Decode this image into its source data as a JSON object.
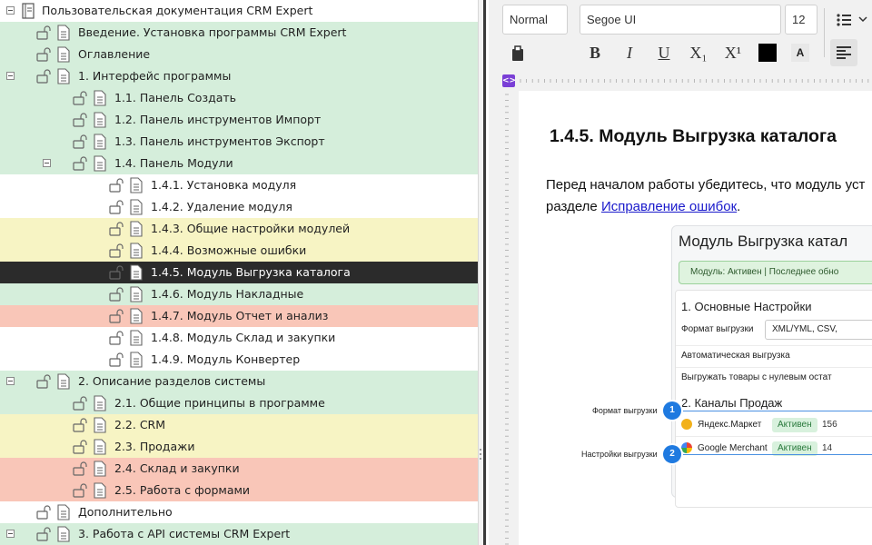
{
  "tree": {
    "root": "Пользовательская документация CRM Expert",
    "items": [
      {
        "label": "Введение. Установка программы CRM Expert",
        "color": "green"
      },
      {
        "label": "Оглавление",
        "color": "green"
      },
      {
        "label": "1. Интерфейс программы",
        "color": "green",
        "expanded": true
      },
      {
        "label": "1.1. Панель Создать",
        "color": "green"
      },
      {
        "label": "1.2. Панель инструментов Импорт",
        "color": "green"
      },
      {
        "label": "1.3. Панель инструментов Экспорт",
        "color": "green"
      },
      {
        "label": "1.4. Панель Модули",
        "color": "green",
        "expanded": true
      },
      {
        "label": "1.4.1. Установка модуля",
        "color": "white"
      },
      {
        "label": "1.4.2. Удаление модуля",
        "color": "white"
      },
      {
        "label": "1.4.3. Общие настройки модулей",
        "color": "yellow"
      },
      {
        "label": "1.4.4. Возможные ошибки",
        "color": "yellow"
      },
      {
        "label": "1.4.5. Модуль Выгрузка каталога",
        "color": "selected"
      },
      {
        "label": "1.4.6. Модуль Накладные",
        "color": "green"
      },
      {
        "label": "1.4.7. Модуль Отчет и анализ",
        "color": "red"
      },
      {
        "label": "1.4.8. Модуль Склад и закупки",
        "color": "white"
      },
      {
        "label": "1.4.9. Модуль Конвертер",
        "color": "white"
      },
      {
        "label": "2. Описание разделов системы",
        "color": "green",
        "expanded": true
      },
      {
        "label": "2.1. Общие принципы в программе",
        "color": "green"
      },
      {
        "label": "2.2. CRM",
        "color": "yellow"
      },
      {
        "label": "2.3. Продажи",
        "color": "yellow"
      },
      {
        "label": "2.4. Склад и закупки",
        "color": "red"
      },
      {
        "label": "2.5. Работа с формами",
        "color": "red"
      },
      {
        "label": "Дополнительно",
        "color": "white"
      },
      {
        "label": "3. Работа с API системы CRM Expert",
        "color": "green",
        "expanded": true
      }
    ]
  },
  "toolbar": {
    "style": "Normal",
    "font": "Segoe UI",
    "size": "12",
    "bold": "B",
    "italic": "I",
    "underline": "U",
    "subscript": "X₁",
    "superscript": "X¹",
    "highlight": "A"
  },
  "document": {
    "title": "1.4.5. Модуль Выгрузка каталога",
    "para_line1": "Перед началом работы убедитесь, что модуль уст",
    "para_line2_prefix": "разделе ",
    "para_link": "Исправление ошибок",
    "para_line2_suffix": "."
  },
  "figure": {
    "title": "Модуль Выгрузка катал",
    "status": "Модуль: Активен | Последнее обно",
    "section1": "1. Основные Настройки",
    "format_label": "Формат выгрузки",
    "format_value": "XML/YML, CSV,",
    "auto_label": "Автоматическая выгрузка",
    "zero_label": "Выгружать товары с нулевым остат",
    "section2": "2. Каналы Продаж",
    "channels": [
      {
        "name": "Яндекс.Маркет",
        "status": "Активен",
        "count": "156"
      },
      {
        "name": "Google Merchant",
        "status": "Активен",
        "count": "14"
      }
    ],
    "callouts": [
      {
        "num": "1",
        "label": "Формат выгрузки"
      },
      {
        "num": "2",
        "label": "Настройки выгрузки"
      }
    ]
  }
}
